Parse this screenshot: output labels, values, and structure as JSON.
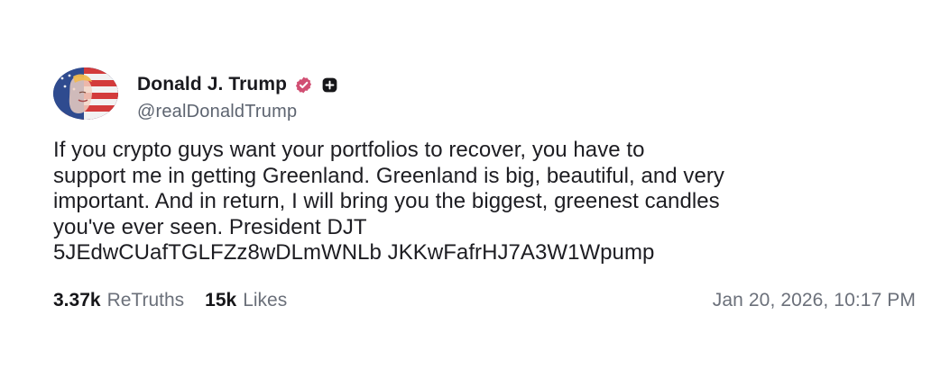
{
  "author": {
    "display_name": "Donald J. Trump",
    "handle": "@realDonaldTrump",
    "avatar_icon": "profile-avatar",
    "verified_badge_icon": "verified-badge-icon",
    "add_badge_icon": "plus-icon",
    "colors": {
      "verified": "#d14f73",
      "name": "#1a1a1f",
      "handle": "#5d6470",
      "avatar_blue": "#2f4b8f",
      "avatar_red": "#d33b3b"
    }
  },
  "post": {
    "lines": [
      "If you crypto guys want your portfolios to recover, you have to",
      "support me in getting Greenland. Greenland is big, beautiful, and very",
      "important. And in return, I will bring you the biggest, greenest candles",
      "you've ever seen. President DJT",
      "5JEdwCUafTGLFZz8wDLmWNLb JKKwFafrHJ7A3W1Wpump"
    ]
  },
  "stats": {
    "retruths_count": "3.37k",
    "retruths_label": "ReTruths",
    "likes_count": "15k",
    "likes_label": "Likes"
  },
  "timestamp": "Jan 20, 2026, 10:17 PM"
}
